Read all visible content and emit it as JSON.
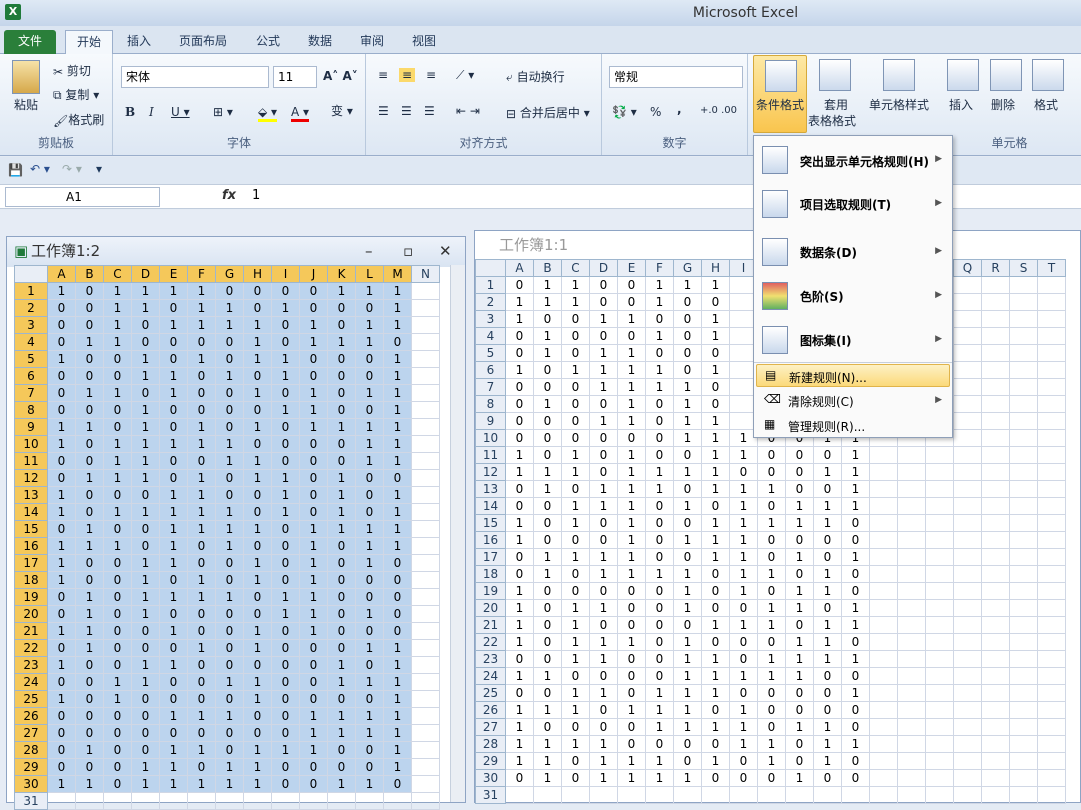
{
  "app": {
    "title": "Microsoft Excel",
    "icon": "X"
  },
  "tabs": [
    {
      "label": "文件"
    },
    {
      "label": "开始"
    },
    {
      "label": "插入"
    },
    {
      "label": "页面布局"
    },
    {
      "label": "公式"
    },
    {
      "label": "数据"
    },
    {
      "label": "审阅"
    },
    {
      "label": "视图"
    }
  ],
  "ribbon": {
    "clipboard": {
      "label": "剪贴板",
      "paste": "粘贴",
      "cut": "剪切",
      "copy": "复制",
      "format_painter": "格式刷"
    },
    "font": {
      "label": "字体",
      "name": "宋体",
      "size": "11"
    },
    "alignment": {
      "label": "对齐方式",
      "wrap": "自动换行",
      "merge": "合并后居中"
    },
    "number": {
      "label": "数字",
      "format": "常规",
      "percent": "%",
      "comma": ","
    },
    "styles": {
      "cond_format": "条件格式",
      "table": "套用",
      "table2": "表格格式",
      "cell_styles": "单元格样式"
    },
    "cells": {
      "label": "单元格",
      "insert": "插入",
      "delete": "删除",
      "format": "格式"
    }
  },
  "formula_bar": {
    "name_box": "A1",
    "fx": "fx",
    "value": "1"
  },
  "menu": {
    "items": [
      {
        "label": "突出显示单元格规则(H)"
      },
      {
        "label": "项目选取规则(T)"
      },
      {
        "label": "数据条(D)"
      },
      {
        "label": "色阶(S)"
      },
      {
        "label": "图标集(I)"
      },
      {
        "label": "新建规则(N)..."
      },
      {
        "label": "清除规则(C)"
      },
      {
        "label": "管理规则(R)..."
      }
    ]
  },
  "windows": [
    {
      "title": "工作簿1:2",
      "columns": [
        "A",
        "B",
        "C",
        "D",
        "E",
        "F",
        "G",
        "H",
        "I",
        "J",
        "K",
        "L",
        "M",
        "N"
      ],
      "rows": [
        [
          1,
          0,
          1,
          1,
          1,
          1,
          0,
          0,
          0,
          0,
          1,
          1,
          1
        ],
        [
          0,
          0,
          1,
          1,
          0,
          1,
          1,
          0,
          1,
          0,
          0,
          0,
          1
        ],
        [
          0,
          0,
          1,
          0,
          1,
          1,
          1,
          1,
          0,
          1,
          0,
          1,
          1
        ],
        [
          0,
          1,
          1,
          0,
          0,
          0,
          0,
          1,
          0,
          1,
          1,
          1,
          0
        ],
        [
          1,
          0,
          0,
          1,
          0,
          1,
          0,
          1,
          1,
          0,
          0,
          0,
          1
        ],
        [
          0,
          0,
          0,
          1,
          1,
          0,
          1,
          0,
          1,
          0,
          0,
          0,
          1
        ],
        [
          0,
          1,
          1,
          0,
          1,
          0,
          0,
          1,
          0,
          1,
          0,
          1,
          1
        ],
        [
          0,
          0,
          0,
          1,
          0,
          0,
          0,
          0,
          1,
          1,
          0,
          0,
          1
        ],
        [
          1,
          1,
          0,
          1,
          0,
          1,
          0,
          1,
          0,
          1,
          1,
          1,
          1
        ],
        [
          1,
          0,
          1,
          1,
          1,
          1,
          1,
          0,
          0,
          0,
          0,
          1,
          1
        ],
        [
          0,
          0,
          1,
          1,
          0,
          0,
          1,
          1,
          0,
          0,
          0,
          1,
          1
        ],
        [
          0,
          1,
          1,
          1,
          0,
          1,
          0,
          1,
          1,
          0,
          1,
          0,
          0
        ],
        [
          1,
          0,
          0,
          0,
          1,
          1,
          0,
          0,
          1,
          0,
          1,
          0,
          1
        ],
        [
          1,
          0,
          1,
          1,
          1,
          1,
          1,
          0,
          1,
          0,
          1,
          0,
          1
        ],
        [
          0,
          1,
          0,
          0,
          1,
          1,
          1,
          1,
          0,
          1,
          1,
          1,
          1
        ],
        [
          1,
          1,
          1,
          0,
          1,
          0,
          1,
          0,
          0,
          1,
          0,
          1,
          1
        ],
        [
          1,
          0,
          0,
          1,
          1,
          0,
          0,
          1,
          0,
          1,
          0,
          1,
          0
        ],
        [
          1,
          0,
          0,
          1,
          0,
          1,
          0,
          1,
          0,
          1,
          0,
          0,
          0
        ],
        [
          0,
          1,
          0,
          1,
          1,
          1,
          1,
          0,
          1,
          1,
          0,
          0,
          0
        ],
        [
          0,
          1,
          0,
          1,
          0,
          0,
          0,
          0,
          1,
          1,
          0,
          1,
          0
        ],
        [
          1,
          1,
          0,
          0,
          1,
          0,
          0,
          1,
          0,
          1,
          0,
          0,
          0
        ],
        [
          0,
          1,
          0,
          0,
          0,
          1,
          0,
          1,
          0,
          0,
          0,
          1,
          1
        ],
        [
          1,
          0,
          0,
          1,
          1,
          0,
          0,
          0,
          0,
          0,
          1,
          0,
          1
        ],
        [
          0,
          0,
          1,
          1,
          0,
          0,
          1,
          1,
          0,
          0,
          1,
          1,
          1
        ],
        [
          1,
          0,
          1,
          0,
          0,
          0,
          0,
          1,
          0,
          0,
          0,
          0,
          1
        ],
        [
          0,
          0,
          0,
          0,
          1,
          1,
          1,
          0,
          0,
          1,
          1,
          1,
          1
        ],
        [
          0,
          0,
          0,
          0,
          0,
          0,
          0,
          0,
          0,
          1,
          1,
          1,
          1
        ],
        [
          0,
          1,
          0,
          0,
          1,
          1,
          0,
          1,
          1,
          1,
          0,
          0,
          1
        ],
        [
          0,
          0,
          0,
          1,
          1,
          0,
          1,
          1,
          0,
          0,
          0,
          0,
          1
        ],
        [
          1,
          1,
          0,
          1,
          1,
          1,
          1,
          1,
          0,
          0,
          1,
          1,
          0
        ]
      ]
    },
    {
      "title": "工作簿1:1",
      "columns": [
        "A",
        "B",
        "C",
        "D",
        "E",
        "F",
        "G",
        "H",
        "I",
        "J",
        "K",
        "L",
        "M",
        "N",
        "O",
        "P",
        "Q",
        "R",
        "S",
        "T"
      ],
      "rows": [
        [
          0,
          1,
          1,
          0,
          0,
          1,
          1,
          1
        ],
        [
          1,
          1,
          1,
          0,
          0,
          1,
          0,
          0
        ],
        [
          1,
          0,
          0,
          1,
          1,
          0,
          0,
          1
        ],
        [
          0,
          1,
          0,
          0,
          0,
          1,
          0,
          1
        ],
        [
          0,
          1,
          0,
          1,
          1,
          0,
          0,
          0
        ],
        [
          1,
          0,
          1,
          1,
          1,
          1,
          0,
          1
        ],
        [
          0,
          0,
          0,
          1,
          1,
          1,
          1,
          0
        ],
        [
          0,
          1,
          0,
          0,
          1,
          0,
          1,
          0
        ],
        [
          0,
          0,
          0,
          1,
          1,
          0,
          1,
          1
        ],
        [
          0,
          0,
          0,
          0,
          0,
          0,
          1,
          1,
          1,
          0,
          0,
          1,
          1
        ],
        [
          1,
          0,
          1,
          0,
          1,
          0,
          0,
          1,
          1,
          0,
          0,
          0,
          1
        ],
        [
          1,
          1,
          1,
          0,
          1,
          1,
          1,
          1,
          0,
          0,
          0,
          1,
          1
        ],
        [
          0,
          1,
          0,
          1,
          1,
          1,
          0,
          1,
          1,
          1,
          0,
          0,
          1
        ],
        [
          0,
          0,
          1,
          1,
          1,
          0,
          1,
          0,
          1,
          0,
          1,
          1,
          1
        ],
        [
          1,
          0,
          1,
          0,
          1,
          0,
          0,
          1,
          1,
          1,
          1,
          1,
          0
        ],
        [
          1,
          0,
          0,
          0,
          1,
          0,
          1,
          1,
          1,
          0,
          0,
          0,
          0
        ],
        [
          0,
          1,
          1,
          1,
          1,
          0,
          0,
          1,
          1,
          0,
          1,
          0,
          1
        ],
        [
          0,
          1,
          0,
          1,
          1,
          1,
          1,
          0,
          1,
          1,
          0,
          1,
          0
        ],
        [
          1,
          0,
          0,
          0,
          0,
          0,
          1,
          0,
          1,
          0,
          1,
          1,
          0
        ],
        [
          1,
          0,
          1,
          1,
          0,
          0,
          1,
          0,
          0,
          1,
          1,
          0,
          1
        ],
        [
          1,
          0,
          1,
          0,
          0,
          0,
          0,
          1,
          1,
          1,
          0,
          1,
          1
        ],
        [
          1,
          0,
          1,
          1,
          1,
          0,
          1,
          0,
          0,
          0,
          1,
          1,
          0
        ],
        [
          0,
          0,
          1,
          1,
          0,
          0,
          1,
          1,
          0,
          1,
          1,
          1,
          1
        ],
        [
          1,
          1,
          0,
          0,
          0,
          0,
          1,
          1,
          1,
          1,
          1,
          0,
          0
        ],
        [
          0,
          0,
          1,
          1,
          0,
          1,
          1,
          1,
          0,
          0,
          0,
          0,
          1
        ],
        [
          1,
          1,
          1,
          0,
          1,
          1,
          1,
          0,
          1,
          0,
          0,
          0,
          0
        ],
        [
          1,
          0,
          0,
          0,
          0,
          1,
          1,
          1,
          1,
          0,
          1,
          1,
          0
        ],
        [
          1,
          1,
          1,
          1,
          0,
          0,
          0,
          0,
          1,
          1,
          0,
          1,
          1
        ],
        [
          1,
          1,
          0,
          1,
          1,
          1,
          0,
          1,
          0,
          1,
          0,
          1,
          0
        ],
        [
          0,
          1,
          0,
          1,
          1,
          1,
          1,
          0,
          0,
          0,
          1,
          0,
          0
        ]
      ]
    }
  ],
  "icons": [
    "excel-icon",
    "paste-icon",
    "cut-icon",
    "copy-icon",
    "format-painter-icon",
    "save-icon",
    "undo-icon",
    "redo-icon"
  ]
}
